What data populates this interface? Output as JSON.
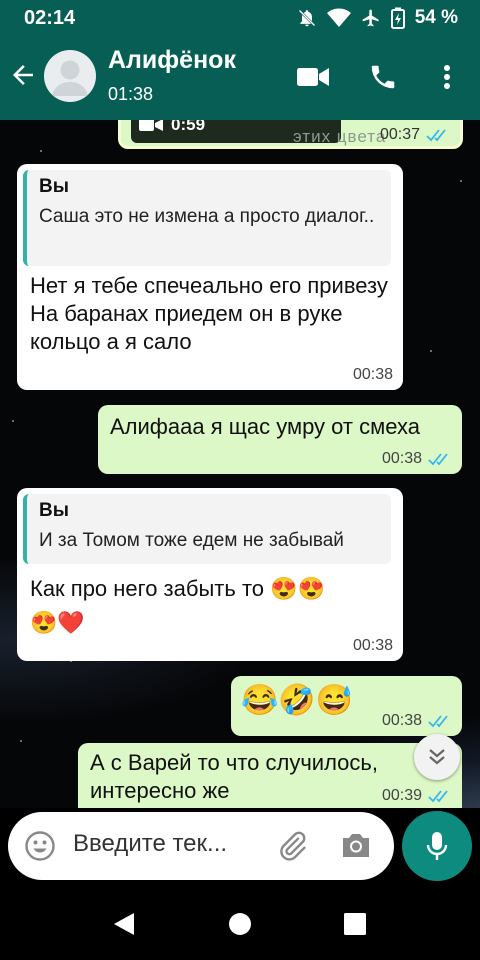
{
  "status_bar": {
    "time": "02:14",
    "battery": "54 %"
  },
  "header": {
    "contact_name": "Алифёнок",
    "contact_status": "01:38"
  },
  "messages": [
    {
      "dir": "out",
      "voice_duration": "0:59",
      "caption_fragment": "этих цвета",
      "time": "00:37",
      "read": true
    },
    {
      "dir": "in",
      "quote_author": "Вы",
      "quote_text": "Саша это не измена а просто диалог..",
      "text": "Нет я тебе спечеально его привезу\nНа баранах приедем он в руке кольцо а я сало",
      "time": "00:38"
    },
    {
      "dir": "out",
      "text": "Алифааа я щас умру от смеха",
      "time": "00:38",
      "read": true
    },
    {
      "dir": "in",
      "quote_author": "Вы",
      "quote_text": "И за Томом тоже едем не забывай",
      "text": "Как про него забыть то 😍😍\n😍❤️",
      "time": "00:38"
    },
    {
      "dir": "out",
      "text": "😂🤣😅",
      "time": "00:38",
      "read": true
    },
    {
      "dir": "out",
      "text": "А с Варей то что случилось, интересно же",
      "time": "00:39",
      "read": true
    }
  ],
  "input": {
    "placeholder": "Введите тек..."
  },
  "icons": [
    "back-arrow",
    "avatar-placeholder",
    "video-call",
    "voice-call",
    "more-vert",
    "emoji",
    "attach",
    "camera",
    "mic",
    "double-chevron-down",
    "nav-back",
    "nav-home",
    "nav-recents"
  ],
  "colors": {
    "header": "#075E54",
    "outgoing": "#DCF8C6",
    "incoming": "#FFFFFF",
    "mic": "#0E8B7F",
    "read_ticks": "#34B7F1",
    "quote_bar": "#35B2A6"
  }
}
